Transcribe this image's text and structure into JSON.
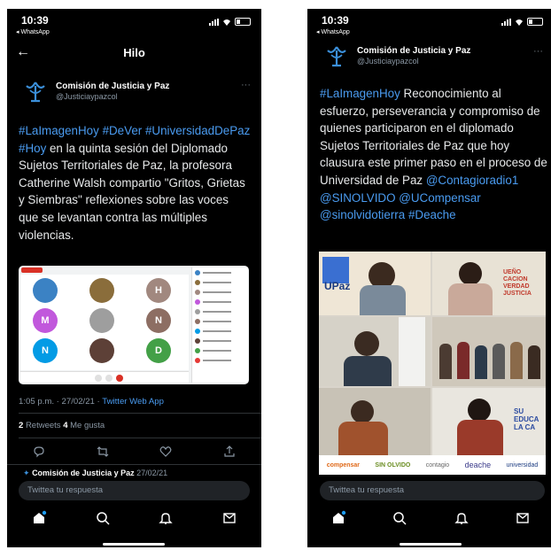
{
  "left": {
    "status": {
      "time": "10:39",
      "back_app": "◂ WhatsApp"
    },
    "title": "Hilo",
    "author": {
      "name": "Comisión de Justicia y Paz",
      "handle": "@Justiciaypazcol",
      "more": "···"
    },
    "text": {
      "h1": "#LaImagenHoy",
      "h2": "#DeVer",
      "h3": "#UniversidadDePaz",
      "h4": "#Hoy",
      "body": " en la quinta sesión del Diplomado Sujetos Territoriales de Paz, la profesora Catherine Walsh compartio \"Gritos, Grietas y Siembras\" reflexiones sobre las voces que se levantan contra las múltiples violencias."
    },
    "meet": {
      "tiles": [
        {
          "letter": "",
          "color": "#3b82c4"
        },
        {
          "letter": "",
          "color": "#8a6d3b"
        },
        {
          "letter": "H",
          "color": "#a1887f"
        },
        {
          "letter": "M",
          "color": "#c158dc"
        },
        {
          "letter": "",
          "color": "#9e9e9e"
        },
        {
          "letter": "N",
          "color": "#8d6e63"
        },
        {
          "letter": "N",
          "color": "#039be5"
        },
        {
          "letter": "",
          "color": "#5d4037"
        },
        {
          "letter": "D",
          "color": "#43a047"
        }
      ],
      "rec_color": "#d93025",
      "participants_panel_color": "#ffffff"
    },
    "meta": {
      "time": "1:05 p.m.",
      "sep": " · ",
      "date": "27/02/21",
      "dot": " · ",
      "via": "Twitter Web App"
    },
    "stats": {
      "retweets_count": "2",
      "retweets_label": "Retweets",
      "likes_count": "4",
      "likes_label": "Me gusta"
    },
    "next_tweet": {
      "name": "Comisión de Justicia y Paz",
      "date": "27/02/21"
    },
    "reply_placeholder": "Twittea tu respuesta",
    "icons": [
      "reply-icon",
      "retweet-icon",
      "like-icon",
      "share-icon",
      "home-icon",
      "search-icon",
      "notifications-icon",
      "messages-icon"
    ],
    "colors": {
      "background": "#000000",
      "link": "#4a9bf0",
      "muted": "#8b98a5"
    }
  },
  "right": {
    "status": {
      "time": "10:39",
      "back_app": "◂ WhatsApp"
    },
    "author": {
      "name": "Comisión de Justicia y Paz",
      "handle": "@Justiciaypazcol",
      "more": "···"
    },
    "text": {
      "h1": "#LaImagenHoy",
      "body": "  Reconocimiento al esfuerzo, perseverancia y compromiso de quienes participaron en el diplomado Sujetos Territoriales de Paz que hoy clausura este primer paso en el proceso de Universidad de Paz ",
      "m1": "@Contagioradio1",
      "m2": "@SINOLVIDO",
      "m3": "@UCompensar",
      "m4": "@sinolvidotierra",
      "h2": "#Deache"
    },
    "collage": {
      "logo_text": "UPaz",
      "sign_text": "UEÑO CACION VERDAD JUSTICIA",
      "sign_text2": "SU EDUCA LA CA",
      "footer_logos": [
        "compensar",
        "SIN OLVIDO",
        "contagio",
        "deache",
        "universidad"
      ]
    },
    "reply_placeholder": "Twittea tu respuesta"
  }
}
